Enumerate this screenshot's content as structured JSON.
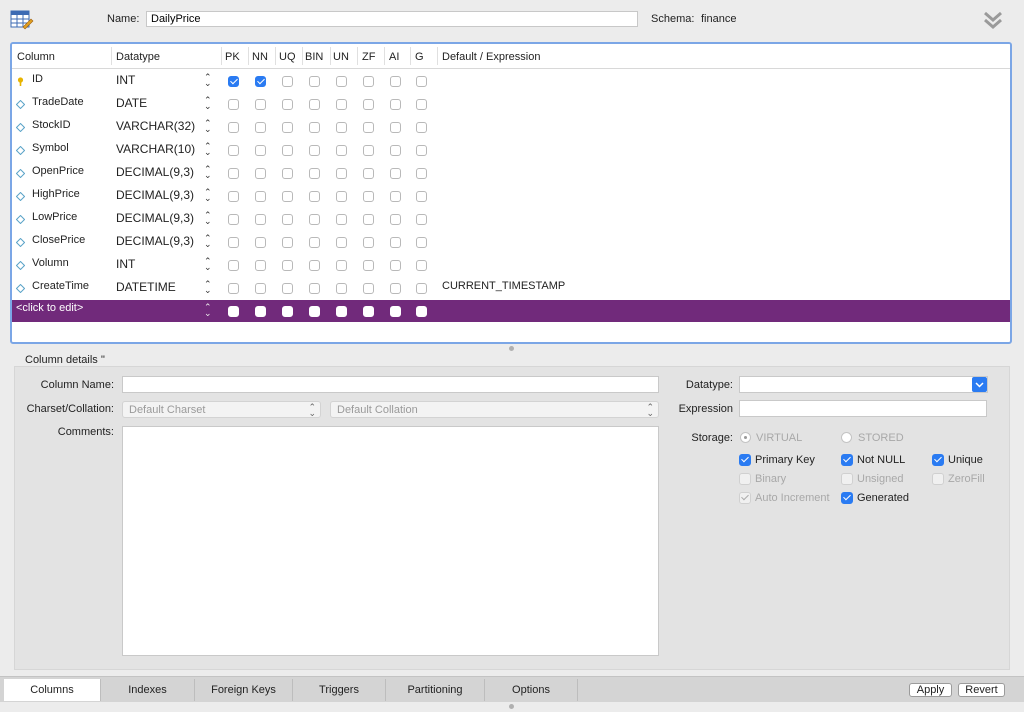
{
  "header": {
    "name_label": "Name:",
    "name_value": "DailyPrice",
    "schema_label": "Schema:",
    "schema_value": "finance"
  },
  "grid": {
    "headers": [
      "Column",
      "Datatype",
      "PK",
      "NN",
      "UQ",
      "BIN",
      "UN",
      "ZF",
      "AI",
      "G",
      "Default / Expression"
    ],
    "rows": [
      {
        "name": "ID",
        "type": "INT",
        "flags": [
          1,
          1,
          0,
          0,
          0,
          0,
          0,
          0
        ],
        "default": "",
        "key": true
      },
      {
        "name": "TradeDate",
        "type": "DATE",
        "flags": [
          0,
          0,
          0,
          0,
          0,
          0,
          0,
          0
        ],
        "default": ""
      },
      {
        "name": "StockID",
        "type": "VARCHAR(32)",
        "flags": [
          0,
          0,
          0,
          0,
          0,
          0,
          0,
          0
        ],
        "default": ""
      },
      {
        "name": "Symbol",
        "type": "VARCHAR(10)",
        "flags": [
          0,
          0,
          0,
          0,
          0,
          0,
          0,
          0
        ],
        "default": ""
      },
      {
        "name": "OpenPrice",
        "type": "DECIMAL(9,3)",
        "flags": [
          0,
          0,
          0,
          0,
          0,
          0,
          0,
          0
        ],
        "default": ""
      },
      {
        "name": "HighPrice",
        "type": "DECIMAL(9,3)",
        "flags": [
          0,
          0,
          0,
          0,
          0,
          0,
          0,
          0
        ],
        "default": ""
      },
      {
        "name": "LowPrice",
        "type": "DECIMAL(9,3)",
        "flags": [
          0,
          0,
          0,
          0,
          0,
          0,
          0,
          0
        ],
        "default": ""
      },
      {
        "name": "ClosePrice",
        "type": "DECIMAL(9,3)",
        "flags": [
          0,
          0,
          0,
          0,
          0,
          0,
          0,
          0
        ],
        "default": ""
      },
      {
        "name": "Volumn",
        "type": "INT",
        "flags": [
          0,
          0,
          0,
          0,
          0,
          0,
          0,
          0
        ],
        "default": ""
      },
      {
        "name": "CreateTime",
        "type": "DATETIME",
        "flags": [
          0,
          0,
          0,
          0,
          0,
          0,
          0,
          0
        ],
        "default": "CURRENT_TIMESTAMP"
      }
    ],
    "new_row_label": "<click to edit>",
    "selected_row_color": "#712a7b"
  },
  "details": {
    "title": "Column details ''",
    "column_name_label": "Column Name:",
    "column_name_value": "",
    "charset_label": "Charset/Collation:",
    "charset_placeholder": "Default Charset",
    "collation_placeholder": "Default Collation",
    "comments_label": "Comments:",
    "datatype_label": "Datatype:",
    "expression_label": "Expression",
    "storage_label": "Storage:",
    "virtual_label": "VIRTUAL",
    "stored_label": "STORED",
    "primary_key_label": "Primary Key",
    "not_null_label": "Not NULL",
    "unique_label": "Unique",
    "binary_label": "Binary",
    "unsigned_label": "Unsigned",
    "zerofill_label": "ZeroFill",
    "auto_increment_label": "Auto Increment",
    "generated_label": "Generated"
  },
  "tabs": [
    "Columns",
    "Indexes",
    "Foreign Keys",
    "Triggers",
    "Partitioning",
    "Options"
  ],
  "buttons": {
    "apply": "Apply",
    "revert": "Revert"
  },
  "colors": {
    "accent": "#2a7bf2",
    "grid_border": "#7ba6e6"
  }
}
